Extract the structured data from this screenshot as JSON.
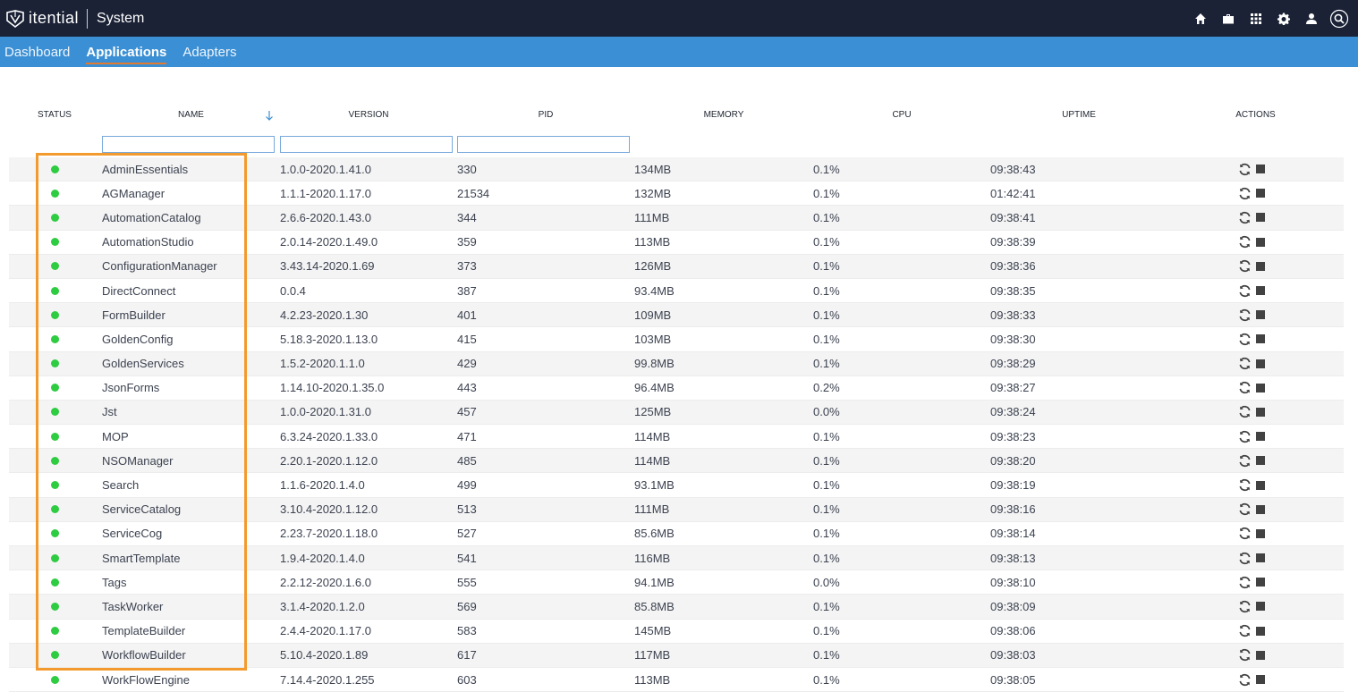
{
  "brand": {
    "name": "itential",
    "title": "System"
  },
  "top_icons": [
    "home-icon",
    "briefcase-icon",
    "grid-icon",
    "gear-icon",
    "user-icon",
    "search-icon"
  ],
  "nav": {
    "tabs": [
      {
        "label": "Dashboard",
        "active": false
      },
      {
        "label": "Applications",
        "active": true
      },
      {
        "label": "Adapters",
        "active": false
      }
    ]
  },
  "table": {
    "columns": [
      "STATUS",
      "NAME",
      "VERSION",
      "PID",
      "MEMORY",
      "CPU",
      "UPTIME",
      "ACTIONS"
    ],
    "sort_column": "NAME",
    "filters": {
      "name": "",
      "version": "",
      "pid": ""
    },
    "status_color": "#2ecc40",
    "rows": [
      {
        "name": "AdminEssentials",
        "version": "1.0.0-2020.1.41.0",
        "pid": "330",
        "memory": "134MB",
        "cpu": "0.1%",
        "uptime": "09:38:43"
      },
      {
        "name": "AGManager",
        "version": "1.1.1-2020.1.17.0",
        "pid": "21534",
        "memory": "132MB",
        "cpu": "0.1%",
        "uptime": "01:42:41"
      },
      {
        "name": "AutomationCatalog",
        "version": "2.6.6-2020.1.43.0",
        "pid": "344",
        "memory": "111MB",
        "cpu": "0.1%",
        "uptime": "09:38:41"
      },
      {
        "name": "AutomationStudio",
        "version": "2.0.14-2020.1.49.0",
        "pid": "359",
        "memory": "113MB",
        "cpu": "0.1%",
        "uptime": "09:38:39"
      },
      {
        "name": "ConfigurationManager",
        "version": "3.43.14-2020.1.69",
        "pid": "373",
        "memory": "126MB",
        "cpu": "0.1%",
        "uptime": "09:38:36"
      },
      {
        "name": "DirectConnect",
        "version": "0.0.4",
        "pid": "387",
        "memory": "93.4MB",
        "cpu": "0.1%",
        "uptime": "09:38:35"
      },
      {
        "name": "FormBuilder",
        "version": "4.2.23-2020.1.30",
        "pid": "401",
        "memory": "109MB",
        "cpu": "0.1%",
        "uptime": "09:38:33"
      },
      {
        "name": "GoldenConfig",
        "version": "5.18.3-2020.1.13.0",
        "pid": "415",
        "memory": "103MB",
        "cpu": "0.1%",
        "uptime": "09:38:30"
      },
      {
        "name": "GoldenServices",
        "version": "1.5.2-2020.1.1.0",
        "pid": "429",
        "memory": "99.8MB",
        "cpu": "0.1%",
        "uptime": "09:38:29"
      },
      {
        "name": "JsonForms",
        "version": "1.14.10-2020.1.35.0",
        "pid": "443",
        "memory": "96.4MB",
        "cpu": "0.2%",
        "uptime": "09:38:27"
      },
      {
        "name": "Jst",
        "version": "1.0.0-2020.1.31.0",
        "pid": "457",
        "memory": "125MB",
        "cpu": "0.0%",
        "uptime": "09:38:24"
      },
      {
        "name": "MOP",
        "version": "6.3.24-2020.1.33.0",
        "pid": "471",
        "memory": "114MB",
        "cpu": "0.1%",
        "uptime": "09:38:23"
      },
      {
        "name": "NSOManager",
        "version": "2.20.1-2020.1.12.0",
        "pid": "485",
        "memory": "114MB",
        "cpu": "0.1%",
        "uptime": "09:38:20"
      },
      {
        "name": "Search",
        "version": "1.1.6-2020.1.4.0",
        "pid": "499",
        "memory": "93.1MB",
        "cpu": "0.1%",
        "uptime": "09:38:19"
      },
      {
        "name": "ServiceCatalog",
        "version": "3.10.4-2020.1.12.0",
        "pid": "513",
        "memory": "111MB",
        "cpu": "0.1%",
        "uptime": "09:38:16"
      },
      {
        "name": "ServiceCog",
        "version": "2.23.7-2020.1.18.0",
        "pid": "527",
        "memory": "85.6MB",
        "cpu": "0.1%",
        "uptime": "09:38:14"
      },
      {
        "name": "SmartTemplate",
        "version": "1.9.4-2020.1.4.0",
        "pid": "541",
        "memory": "116MB",
        "cpu": "0.1%",
        "uptime": "09:38:13"
      },
      {
        "name": "Tags",
        "version": "2.2.12-2020.1.6.0",
        "pid": "555",
        "memory": "94.1MB",
        "cpu": "0.0%",
        "uptime": "09:38:10"
      },
      {
        "name": "TaskWorker",
        "version": "3.1.4-2020.1.2.0",
        "pid": "569",
        "memory": "85.8MB",
        "cpu": "0.1%",
        "uptime": "09:38:09"
      },
      {
        "name": "TemplateBuilder",
        "version": "2.4.4-2020.1.17.0",
        "pid": "583",
        "memory": "145MB",
        "cpu": "0.1%",
        "uptime": "09:38:06"
      },
      {
        "name": "WorkflowBuilder",
        "version": "5.10.4-2020.1.89",
        "pid": "617",
        "memory": "117MB",
        "cpu": "0.1%",
        "uptime": "09:38:03"
      },
      {
        "name": "WorkFlowEngine",
        "version": "7.14.4-2020.1.255",
        "pid": "603",
        "memory": "113MB",
        "cpu": "0.1%",
        "uptime": "09:38:05"
      }
    ]
  },
  "highlight_color": "#f39a2e"
}
